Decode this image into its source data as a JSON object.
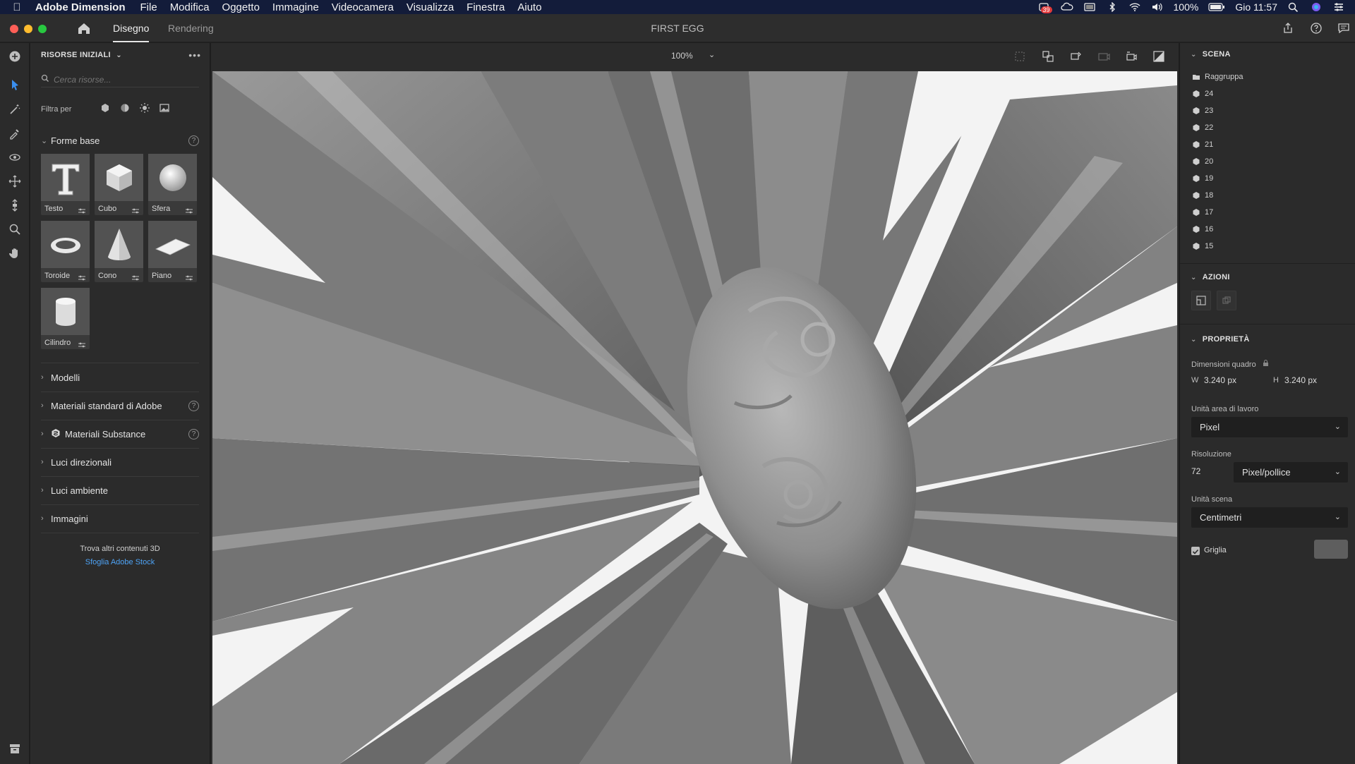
{
  "menubar": {
    "app_name": "Adobe Dimension",
    "items": [
      "File",
      "Modifica",
      "Oggetto",
      "Immagine",
      "Videocamera",
      "Visualizza",
      "Finestra",
      "Aiuto"
    ],
    "badge_count": "39",
    "battery": "100%",
    "clock": "Gio 11:57"
  },
  "titlebar": {
    "tab_design": "Disegno",
    "tab_render": "Rendering",
    "document_title": "FIRST EGG"
  },
  "assets": {
    "header": "RISORSE INIZIALI",
    "search_placeholder": "Cerca risorse...",
    "filter_label": "Filtra per",
    "basic_shapes_title": "Forme base",
    "tiles": [
      "Testo",
      "Cubo",
      "Sfera",
      "Toroide",
      "Cono",
      "Piano",
      "Cilindro"
    ],
    "sections": [
      "Modelli",
      "Materiali standard di Adobe",
      "Materiali Substance",
      "Luci direzionali",
      "Luci ambiente",
      "Immagini"
    ],
    "find_more": "Trova altri contenuti 3D",
    "stock_link": "Sfoglia Adobe Stock"
  },
  "canvas": {
    "zoom": "100%"
  },
  "scene": {
    "header": "SCENA",
    "group_label": "Raggruppa",
    "items": [
      "24",
      "23",
      "22",
      "21",
      "20",
      "19",
      "18",
      "17",
      "16",
      "15"
    ]
  },
  "actions": {
    "header": "AZIONI"
  },
  "properties": {
    "header": "PROPRIETÀ",
    "canvas_size_label": "Dimensioni quadro",
    "w_label": "W",
    "w_value": "3.240 px",
    "h_label": "H",
    "h_value": "3.240 px",
    "doc_units_label": "Unità area di lavoro",
    "doc_units_value": "Pixel",
    "resolution_label": "Risoluzione",
    "resolution_value": "72",
    "resolution_unit": "Pixel/pollice",
    "scene_units_label": "Unità scena",
    "scene_units_value": "Centimetri",
    "grid_label": "Griglia",
    "grid_checked": true
  },
  "colors": {
    "accent_link": "#4ea3f5",
    "menubar_bg": "#131c3a",
    "panel_bg": "#2b2b2b"
  }
}
